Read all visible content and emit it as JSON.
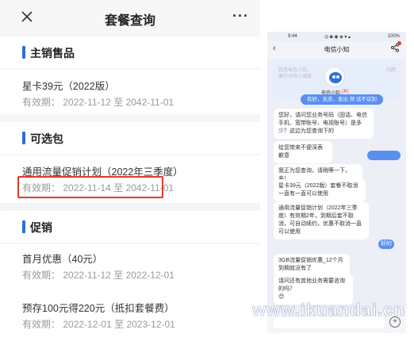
{
  "left": {
    "title": "套餐查询",
    "more": "···",
    "sections": [
      {
        "title": "主销售品",
        "items": [
          {
            "name": "星卡39元（2022版）",
            "period_label": "有效期：",
            "start": "2022-11-12",
            "sep": "至",
            "end": "2042-11-01"
          }
        ]
      },
      {
        "title": "可选包",
        "items": [
          {
            "name": "通用流量促销计划（2022年三季度）",
            "period_label": "有效期：",
            "start": "2022-11-14",
            "sep": "至",
            "end": "2042-11-01"
          }
        ]
      },
      {
        "title": "促销",
        "items": [
          {
            "name": "首月优惠（40元）",
            "period_label": "有效期：",
            "start": "2022-11-12",
            "sep": "至",
            "end": "2022-12-01"
          },
          {
            "name": "预存100元得220元（抵扣套餐费）",
            "period_label": "有效期：",
            "start": "2022-12-01",
            "sep": "至",
            "end": "2023-12-01"
          }
        ]
      }
    ]
  },
  "right": {
    "status": {
      "time": "9:44",
      "icons": "◎ ◙ ◉ ◈ ▾ ▴",
      "battery": "100%"
    },
    "chat_title": "电信小知",
    "banner_faint": [
      "我是电信小知，",
      "偶尔也有小调皮",
      "问题"
    ],
    "bot_name": "电信小知",
    "bot_badge": "AI",
    "pill": "有好，无亦，发出 然 话不议别",
    "messages": [
      {
        "side": "left",
        "text": "您好，请问您业务号码（固话、电信手机、宽带账号、电视账号）是多少？这边为您查询下的"
      },
      {
        "side": "left",
        "text": "给您带来不便深表歉意"
      },
      {
        "side": "right",
        "text": ""
      },
      {
        "side": "left",
        "text": "我正为您查询，请稍等一下，亲！"
      },
      {
        "side": "left",
        "text": "星卡39元（2022版）套餐不取消一直有一直可以使用"
      },
      {
        "side": "left",
        "text": "通用流量促销计划（2022年三季度）有效期2年，到期后套不取消，可自动续约，优惠不取消一直可以使用"
      },
      {
        "side": "right",
        "text": "好的"
      },
      {
        "side": "left",
        "text": "3GB流量促销优惠_12个月 到期就没有了"
      },
      {
        "side": "left",
        "text": "请问还有其他业务需要咨询的吗？"
      }
    ],
    "emoji": "😊",
    "watermark": "www.ikuandai.cn"
  }
}
